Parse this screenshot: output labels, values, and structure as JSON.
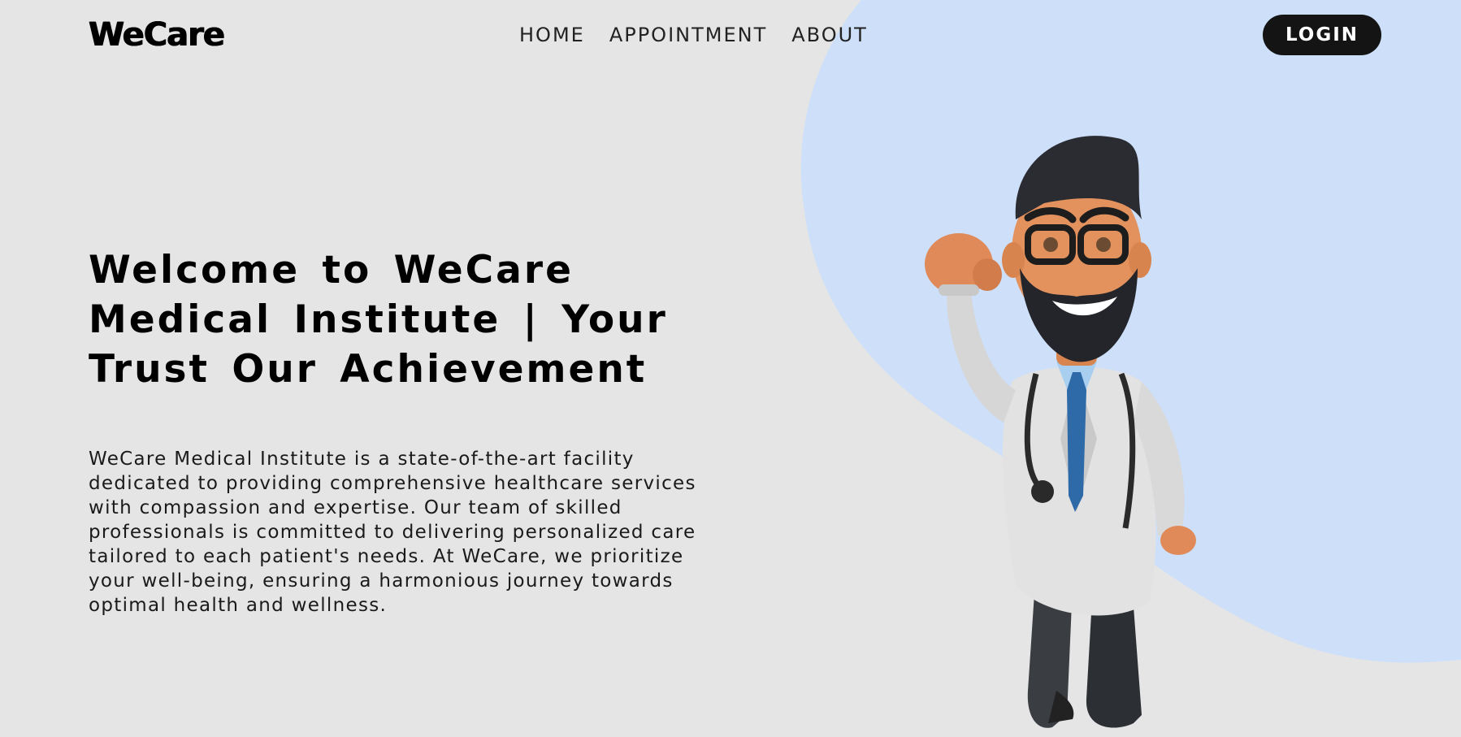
{
  "brand": {
    "logo": "WeCare"
  },
  "nav": {
    "items": [
      "HOME",
      "APPOINTMENT",
      "ABOUT"
    ],
    "login_label": "LOGIN"
  },
  "hero": {
    "title": "Welcome to WeCare Medical Institute | Your Trust Our Achievement",
    "description": "WeCare Medical Institute is a state-of-the-art facility dedicated to providing comprehensive healthcare services with compassion and expertise. Our team of skilled professionals is committed to delivering personalized care tailored to each patient's needs. At WeCare, we prioritize your well-being, ensuring a harmonious journey towards optimal health and wellness.",
    "illustration": "cartoon-doctor-superhero-illustration"
  },
  "colors": {
    "background": "#e5e5e5",
    "accent_blob": "#cddff9",
    "button": "#141414",
    "text": "#000000"
  }
}
